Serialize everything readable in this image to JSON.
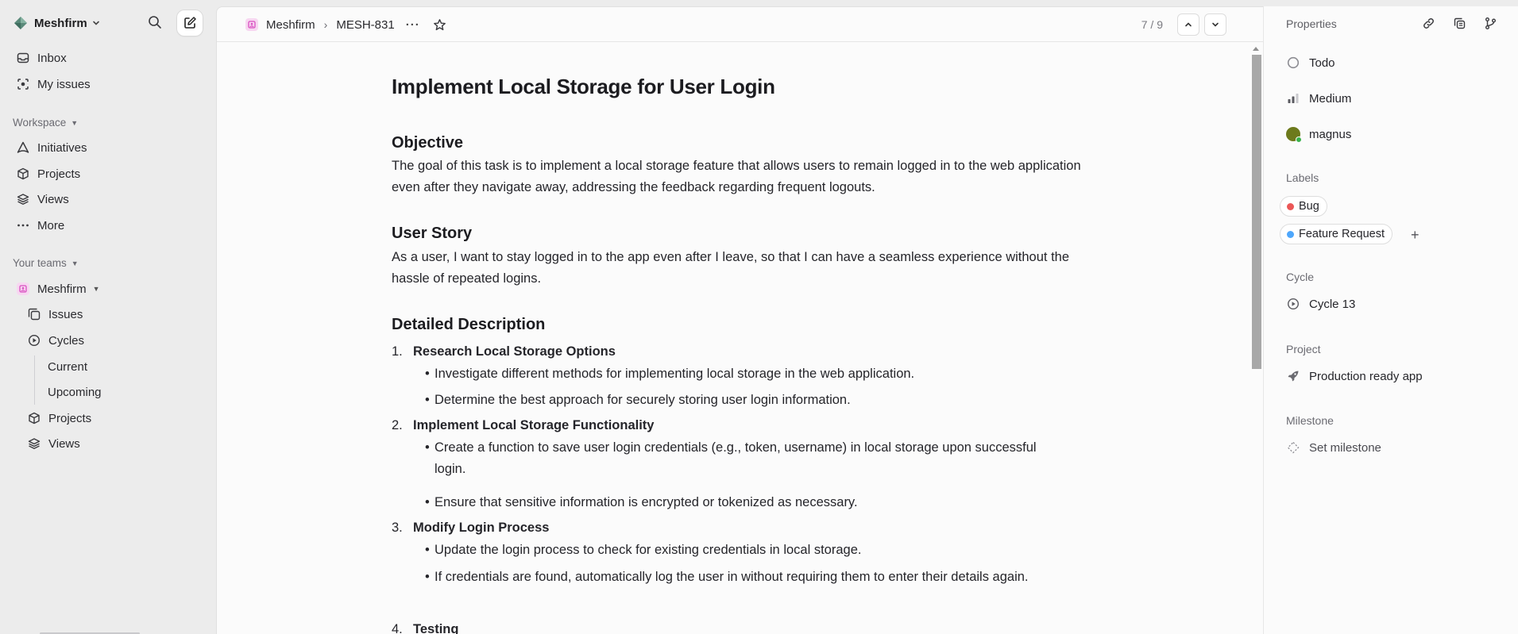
{
  "sidebar": {
    "workspace": "Meshfirm",
    "nav": [
      {
        "label": "Inbox",
        "icon": "inbox-icon"
      },
      {
        "label": "My issues",
        "icon": "my-issues-icon"
      }
    ],
    "workspace_section": "Workspace",
    "workspace_items": [
      {
        "label": "Initiatives",
        "icon": "initiatives-icon"
      },
      {
        "label": "Projects",
        "icon": "projects-icon"
      },
      {
        "label": "Views",
        "icon": "views-icon"
      },
      {
        "label": "More",
        "icon": "more-icon"
      }
    ],
    "teams_section": "Your teams",
    "team": {
      "name": "Meshfirm",
      "items": [
        {
          "label": "Issues",
          "icon": "issues-icon"
        },
        {
          "label": "Cycles",
          "icon": "cycles-icon"
        },
        {
          "label": "Current"
        },
        {
          "label": "Upcoming"
        },
        {
          "label": "Projects",
          "icon": "projects-icon"
        },
        {
          "label": "Views",
          "icon": "views-icon"
        }
      ]
    }
  },
  "header": {
    "team": "Meshfirm",
    "issue_id": "MESH-831",
    "pager": "7 / 9"
  },
  "issue": {
    "title": "Implement Local Storage for User Login",
    "objective_heading": "Objective",
    "objective_text": "The goal of this task is to implement a local storage feature that allows users to remain logged in to the web application even after they navigate away, addressing the feedback regarding frequent logouts.",
    "story_heading": "User Story",
    "story_text": "As a user, I want to stay logged in to the app even after I leave, so that I can have a seamless experience without the hassle of repeated logins.",
    "detail_heading": "Detailed Description",
    "steps": [
      {
        "num": "1.",
        "title": "Research Local Storage Options",
        "bullets": [
          "Investigate different methods for implementing local storage in the web application.",
          "Determine the best approach for securely storing user login information."
        ]
      },
      {
        "num": "2.",
        "title": "Implement Local Storage Functionality",
        "bullets": [
          "Create a function to save user login credentials (e.g., token, username) in local storage upon successful login.",
          "Ensure that sensitive information is encrypted or tokenized as necessary."
        ]
      },
      {
        "num": "3.",
        "title": "Modify Login Process",
        "bullets": [
          "Update the login process to check for existing credentials in local storage.",
          "If credentials are found, automatically log the user in without requiring them to enter their details again."
        ]
      },
      {
        "num": "4.",
        "title": "Testing",
        "bullets": []
      }
    ]
  },
  "properties": {
    "heading": "Properties",
    "status": "Todo",
    "priority": "Medium",
    "assignee": "magnus",
    "labels_heading": "Labels",
    "labels": [
      {
        "name": "Bug",
        "color": "#eb5757"
      },
      {
        "name": "Feature Request",
        "color": "#4ea7fc"
      }
    ],
    "cycle_heading": "Cycle",
    "cycle": "Cycle 13",
    "project_heading": "Project",
    "project": "Production ready app",
    "milestone_heading": "Milestone",
    "milestone": "Set milestone"
  },
  "colors": {
    "team_accent": "#d94fc1",
    "bug": "#eb5757",
    "feature_request": "#4ea7fc",
    "online": "#38b24a"
  }
}
